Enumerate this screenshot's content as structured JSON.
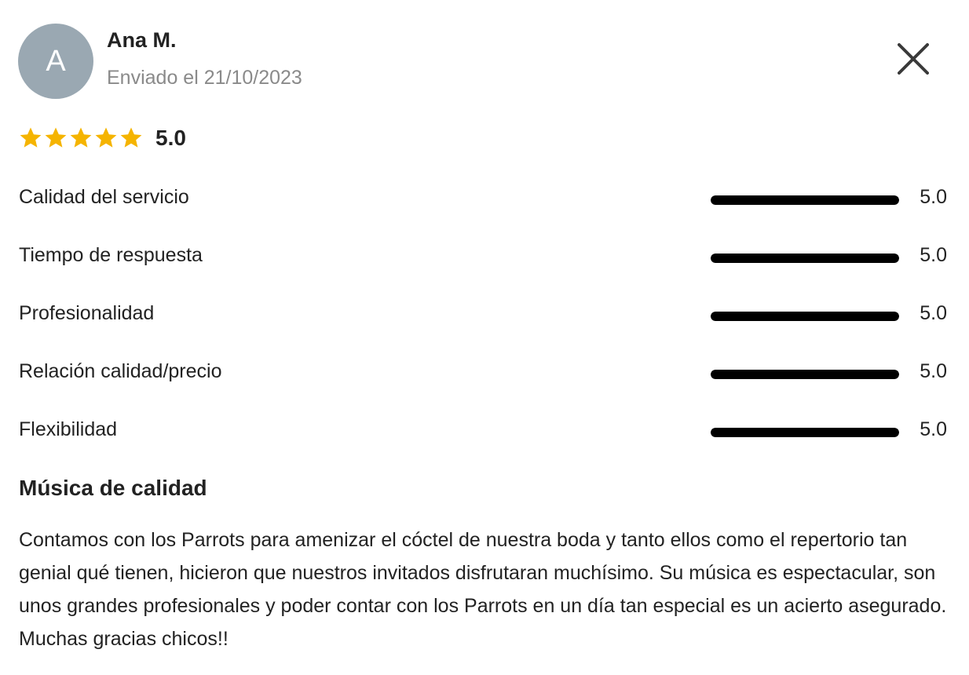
{
  "review": {
    "avatar_letter": "A",
    "author": "Ana M.",
    "sent_date": "Enviado el 21/10/2023",
    "overall_rating": "5.0",
    "stars": 5,
    "star_color": "#f5b400",
    "criteria": [
      {
        "label": "Calidad del servicio",
        "score": "5.0",
        "fill": 1.0
      },
      {
        "label": "Tiempo de respuesta",
        "score": "5.0",
        "fill": 1.0
      },
      {
        "label": "Profesionalidad",
        "score": "5.0",
        "fill": 1.0
      },
      {
        "label": "Relación calidad/precio",
        "score": "5.0",
        "fill": 1.0
      },
      {
        "label": "Flexibilidad",
        "score": "5.0",
        "fill": 1.0
      }
    ],
    "title": "Música de calidad",
    "body": "Contamos con los Parrots para amenizar el cóctel de nuestra boda y tanto ellos como el repertorio tan genial qué tienen, hicieron que nuestros invitados disfrutaran muchísimo. Su música es espectacular, son unos grandes profesionales y poder contar con los Parrots en un día tan especial es un acierto asegurado. Muchas gracias chicos!!"
  },
  "icons": {
    "close": "close-icon",
    "star": "star-icon"
  }
}
